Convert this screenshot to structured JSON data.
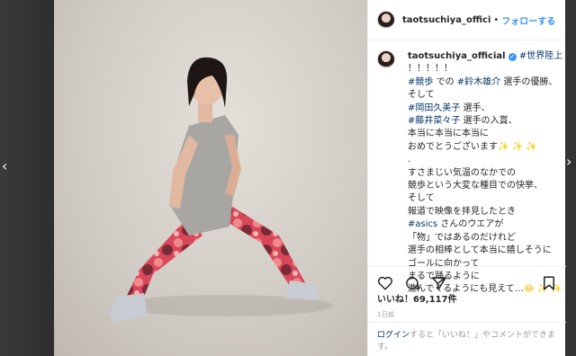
{
  "post": {
    "username": "taotsuchiya_offici",
    "separator": "•",
    "follow_label": "フォローする"
  },
  "caption": {
    "username": "taotsuchiya_official",
    "verified_mark": "✓",
    "lines": [
      {
        "parts": [
          {
            "t": "#世界陸上",
            "tag": true
          }
        ]
      },
      {
        "parts": [
          {
            "t": "！！！！！",
            "tag": false
          }
        ]
      },
      {
        "parts": [
          {
            "t": "#競歩",
            "tag": true
          },
          {
            "t": " での ",
            "tag": false
          },
          {
            "t": "#鈴木雄介",
            "tag": true
          },
          {
            "t": " 選手の優勝、",
            "tag": false
          }
        ]
      },
      {
        "parts": [
          {
            "t": "そして",
            "tag": false
          }
        ]
      },
      {
        "parts": [
          {
            "t": "#岡田久美子",
            "tag": true
          },
          {
            "t": " 選手、",
            "tag": false
          }
        ]
      },
      {
        "parts": [
          {
            "t": "#藤井菜々子",
            "tag": true
          },
          {
            "t": " 選手の入賞、",
            "tag": false
          }
        ]
      },
      {
        "parts": [
          {
            "t": "本当に本当に本当に",
            "tag": false
          }
        ]
      },
      {
        "parts": [
          {
            "t": "おめでとうございます",
            "tag": false
          },
          {
            "t": "✨ ✨ ✨",
            "sparkle": true
          }
        ]
      },
      {
        "parts": [
          {
            "t": ".",
            "tag": false
          }
        ]
      },
      {
        "parts": [
          {
            "t": "すさまじい気温のなかでの",
            "tag": false
          }
        ]
      },
      {
        "parts": [
          {
            "t": "競歩という大変な種目での快挙、",
            "tag": false
          }
        ]
      },
      {
        "parts": [
          {
            "t": "そして",
            "tag": false
          }
        ]
      },
      {
        "parts": [
          {
            "t": "報道で映像を拝見したとき",
            "tag": false
          }
        ]
      },
      {
        "parts": [
          {
            "t": "#asics",
            "tag": true
          },
          {
            "t": " さんのウエアが",
            "tag": false
          }
        ]
      },
      {
        "parts": [
          {
            "t": "「物」ではあるのだけれど",
            "tag": false
          }
        ]
      },
      {
        "parts": [
          {
            "t": "選手の相棒として本当に嬉しそうに",
            "tag": false
          }
        ]
      },
      {
        "parts": [
          {
            "t": "ゴールに向かって",
            "tag": false
          }
        ]
      },
      {
        "parts": [
          {
            "t": "まるで踊るように",
            "tag": false
          }
        ]
      },
      {
        "parts": [
          {
            "t": "進んでくるようにも見えて…",
            "tag": false
          },
          {
            "t": "😂 ✨ ✨",
            "sparkle": true
          }
        ]
      }
    ]
  },
  "actions": {
    "icons": [
      "heart-icon",
      "comment-icon",
      "share-icon",
      "bookmark-icon"
    ]
  },
  "likes_label": "いいね！69,117件",
  "time_label": "1日前",
  "login": {
    "link": "ログイン",
    "text": "すると「いいね！」やコメントができます。"
  },
  "colors": {
    "link_blue": "#3897f0",
    "hashtag": "#003569",
    "muted": "#999999"
  }
}
